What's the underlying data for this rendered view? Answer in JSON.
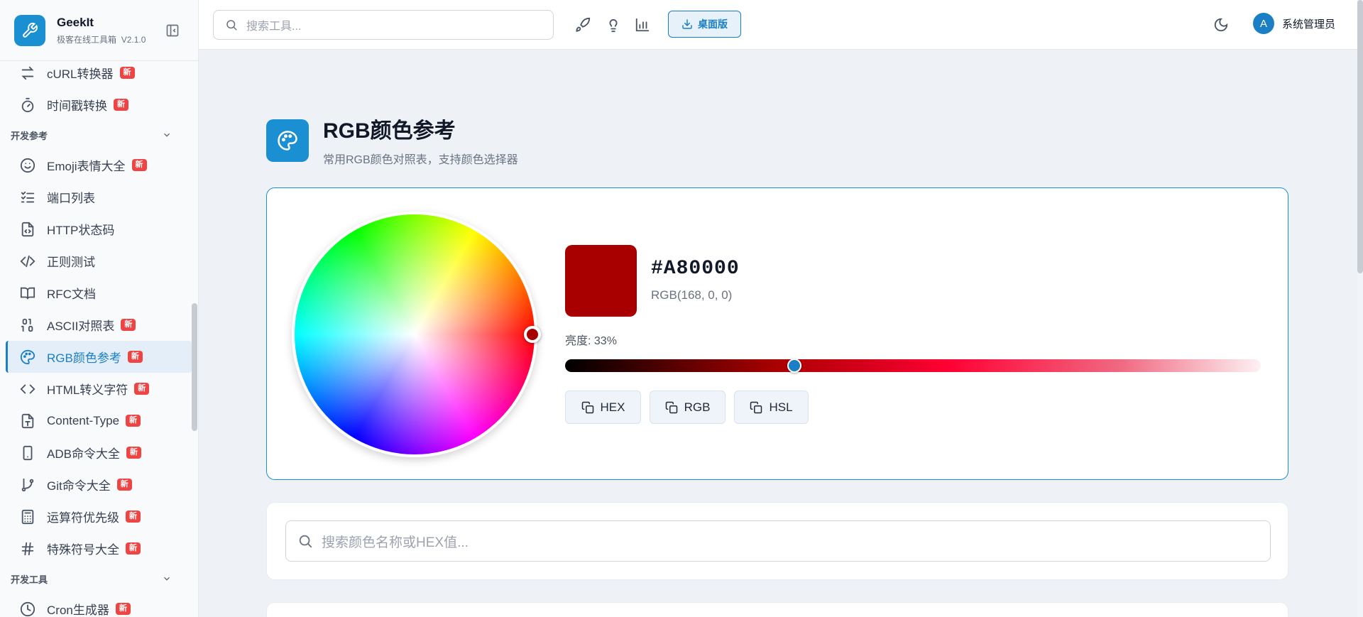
{
  "app": {
    "name": "GeekIt",
    "subtitle": "极客在线工具箱",
    "version": "V2.1.0"
  },
  "header": {
    "search_placeholder": "搜索工具...",
    "desktop_label": "桌面版",
    "user_initial": "A",
    "user_name": "系统管理员"
  },
  "sidebar": {
    "top_items": [
      {
        "label": "cURL转换器",
        "badge": "新",
        "icon": "swap-icon"
      },
      {
        "label": "时间戳转换",
        "badge": "新",
        "icon": "timer-icon"
      }
    ],
    "section_ref": "开发参考",
    "ref_items": [
      {
        "label": "Emoji表情大全",
        "badge": "新",
        "icon": "smile-icon"
      },
      {
        "label": "端口列表",
        "badge": "",
        "icon": "list-check-icon"
      },
      {
        "label": "HTTP状态码",
        "badge": "",
        "icon": "file-code-icon"
      },
      {
        "label": "正则测试",
        "badge": "",
        "icon": "code-icon"
      },
      {
        "label": "RFC文档",
        "badge": "",
        "icon": "book-icon"
      },
      {
        "label": "ASCII对照表",
        "badge": "新",
        "icon": "binary-icon"
      },
      {
        "label": "RGB颜色参考",
        "badge": "新",
        "icon": "palette-icon"
      },
      {
        "label": "HTML转义字符",
        "badge": "新",
        "icon": "brackets-icon"
      },
      {
        "label": "Content-Type",
        "badge": "新",
        "icon": "file-type-icon"
      },
      {
        "label": "ADB命令大全",
        "badge": "新",
        "icon": "phone-icon"
      },
      {
        "label": "Git命令大全",
        "badge": "新",
        "icon": "git-branch-icon"
      },
      {
        "label": "运算符优先级",
        "badge": "新",
        "icon": "calculator-icon"
      },
      {
        "label": "特殊符号大全",
        "badge": "新",
        "icon": "hash-icon"
      }
    ],
    "section_tools": "开发工具",
    "tools_items": [
      {
        "label": "Cron生成器",
        "badge": "新",
        "icon": "clock-icon"
      }
    ]
  },
  "page": {
    "title": "RGB颜色参考",
    "subtitle": "常用RGB颜色对照表，支持颜色选择器"
  },
  "picker": {
    "hex": "#A80000",
    "rgb": "RGB(168, 0, 0)",
    "brightness_label": "亮度: 33%",
    "brightness": 0.33,
    "color": "#a80000",
    "copy_buttons": [
      "HEX",
      "RGB",
      "HSL"
    ]
  },
  "color_search_placeholder": "搜索颜色名称或HEX值...",
  "colors": {
    "accent": "#1a7fc4",
    "badge": "#ef4444"
  }
}
